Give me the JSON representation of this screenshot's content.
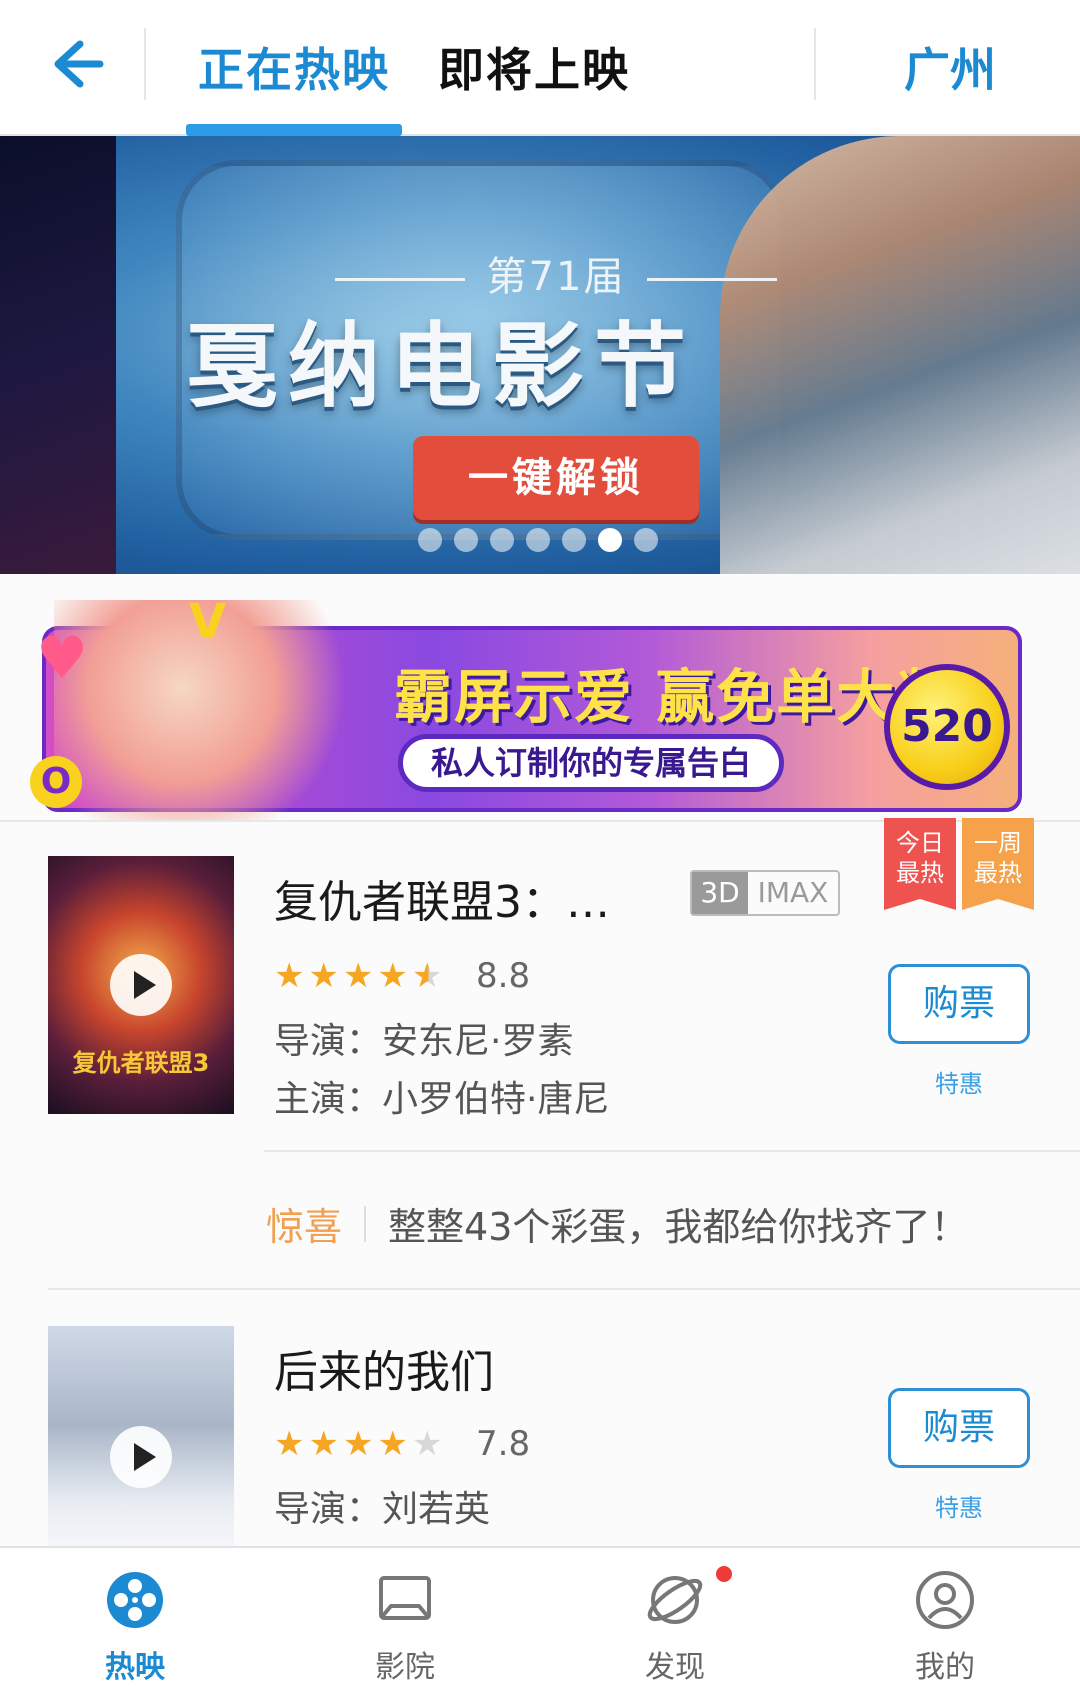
{
  "header": {
    "tabs": [
      {
        "label": "正在热映",
        "active": true
      },
      {
        "label": "即将上映",
        "active": false
      }
    ],
    "city": "广州",
    "accent_color": "#1c8ad2"
  },
  "hero": {
    "edition": "第71届",
    "title": "戛纳电影节",
    "button_label": "一键解锁",
    "slides_total": 7,
    "active_slide": 6
  },
  "promo": {
    "title": "霸屏示爱 赢免单大奖",
    "subtitle": "私人订制你的专属告白",
    "coin_text": "520",
    "letters": [
      "V",
      "O"
    ]
  },
  "movies": [
    {
      "title": "复仇者联盟3：…",
      "format_badge": [
        "3D",
        "IMAX"
      ],
      "ribbons": [
        "今日\n最热",
        "一周\n最热"
      ],
      "rating": 8.8,
      "stars": 4.5,
      "director": "导演：安东尼·罗素",
      "cast": "主演：小罗伯特·唐尼",
      "buy_label": "购票",
      "deal_label": "特惠",
      "poster_logo": "复仇者联盟3"
    },
    {
      "title": "后来的我们",
      "rating": 7.8,
      "stars": 4,
      "director": "导演：刘若英",
      "buy_label": "购票",
      "deal_label": "特惠"
    }
  ],
  "surprise": {
    "tag": "惊喜",
    "text": "整整43个彩蛋，我都给你找齐了！"
  },
  "bottom_nav": [
    {
      "label": "热映",
      "icon": "film-reel-icon",
      "active": true
    },
    {
      "label": "影院",
      "icon": "cinema-screen-icon",
      "active": false
    },
    {
      "label": "发现",
      "icon": "planet-icon",
      "active": false,
      "badge": true
    },
    {
      "label": "我的",
      "icon": "user-icon",
      "active": false
    }
  ]
}
